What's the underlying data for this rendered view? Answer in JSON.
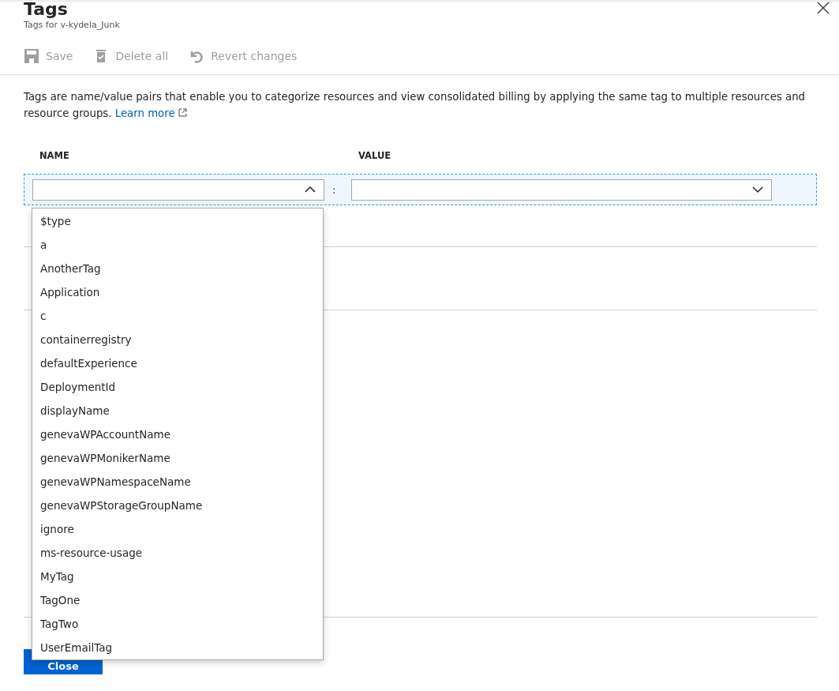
{
  "header": {
    "title": "Tags",
    "subtitle": "Tags for v-kydela_Junk"
  },
  "toolbar": [
    {
      "kind": "save",
      "label": "Save",
      "disabled": true
    },
    {
      "kind": "delete",
      "label": "Delete all",
      "disabled": true
    },
    {
      "kind": "revert",
      "label": "Revert changes",
      "disabled": true
    }
  ],
  "description": {
    "text": "Tags are name/value pairs that enable you to categorize resources and view consolidated billing by applying the same tag to multiple resources and resource groups.",
    "link": "Learn more"
  },
  "columns": [
    "NAME",
    "VALUE"
  ],
  "row": {
    "separator": ":",
    "name_expanded": true
  },
  "dropdown": [
    "$type",
    "a",
    "AnotherTag",
    "Application",
    "c",
    "containerregistry",
    "defaultExperience",
    "DeploymentId",
    "displayName",
    "genevaWPAccountName",
    "genevaWPMonikerName",
    "genevaWPNamespaceName",
    "genevaWPStorageGroupName",
    "ignore",
    "ms-resource-usage",
    "MyTag",
    "TagOne",
    "TagTwo",
    "UserEmailTag"
  ],
  "close_button": "Close"
}
